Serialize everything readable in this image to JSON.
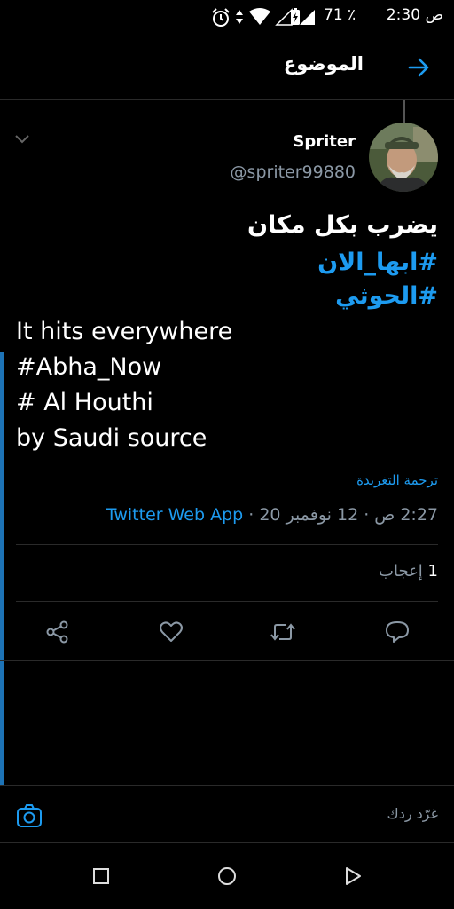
{
  "status_bar": {
    "time": "2:30 ص",
    "battery_percent": "71 ٪"
  },
  "header": {
    "title": "الموضوع"
  },
  "tweet": {
    "author_name": "Spriter",
    "author_handle": "@spriter99880",
    "text_ar": "يضرب بكل مكان",
    "hashtag_abha_ar": "#ابها_الان",
    "hashtag_houthi_ar": "#الحوثي",
    "text_en_1": "It hits everywhere",
    "hashtag_en": "#Abha_Now",
    "text_en_2": "# Al Houthi",
    "text_en_3": "by Saudi source",
    "translate_label": "ترجمة التغريدة",
    "timestamp": "2:27 ص · 12 نوفمبر 20",
    "separator": " · ",
    "source": "Twitter Web App",
    "likes_count": "1",
    "likes_label": "إعجاب"
  },
  "reply": {
    "placeholder": "غرّد ردك"
  },
  "colors": {
    "accent": "#1d9bf0",
    "thread_bar": "#1d73b6",
    "muted": "#8b98a5"
  },
  "icons": [
    "alarm-icon",
    "data-arrows-icon",
    "wifi-icon",
    "signal-icon",
    "battery-icon",
    "back-arrow-icon",
    "chevron-down-icon",
    "share-icon",
    "like-icon",
    "retweet-icon",
    "reply-icon",
    "camera-icon",
    "recents-icon",
    "home-icon",
    "back-icon"
  ]
}
